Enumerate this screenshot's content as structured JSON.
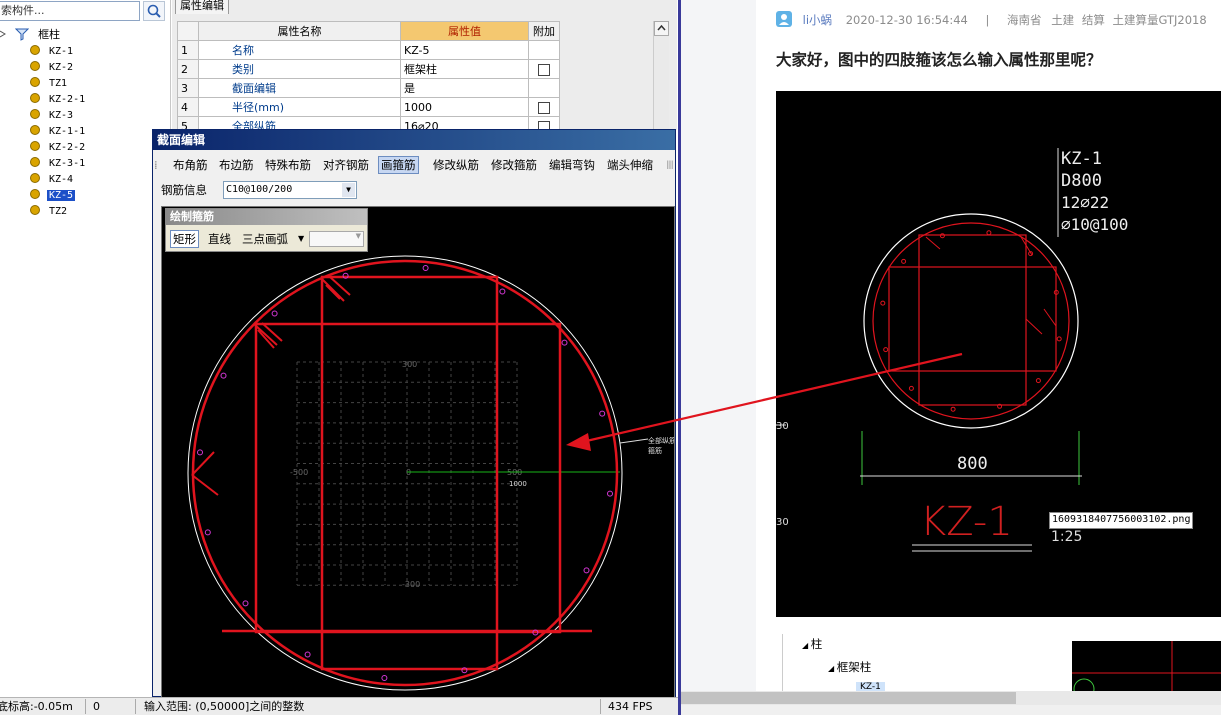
{
  "left_panel": {
    "search_placeholder": "索构件...",
    "tree_root": "框柱",
    "tree_items": [
      "KZ-1",
      "KZ-2",
      "TZ1",
      "KZ-2-1",
      "KZ-3",
      "KZ-1-1",
      "KZ-2-2",
      "KZ-3-1",
      "KZ-4",
      "KZ-5",
      "TZ2"
    ],
    "selected_item": "KZ-5"
  },
  "property_panel": {
    "tab_label": "属性编辑",
    "headers": [
      "属性名称",
      "属性值",
      "附加"
    ],
    "rows": [
      {
        "idx": "1",
        "name": "名称",
        "value": "KZ-5",
        "checkbox": false
      },
      {
        "idx": "2",
        "name": "类别",
        "value": "框架柱",
        "checkbox": true
      },
      {
        "idx": "3",
        "name": "截面编辑",
        "value": "是",
        "checkbox": false
      },
      {
        "idx": "4",
        "name": "半径(mm)",
        "value": "1000",
        "checkbox": true
      },
      {
        "idx": "5",
        "name": "全部纵筋",
        "value": "16⌀20",
        "checkbox": true
      }
    ]
  },
  "section_dialog": {
    "title": "截面编辑",
    "toolbar": [
      "布角筋",
      "布边筋",
      "特殊布筋",
      "对齐钢筋",
      "画箍筋",
      "修改纵筋",
      "修改箍筋",
      "编辑弯钩",
      "端头伸缩"
    ],
    "active_tool": "画箍筋",
    "rebar_info_label": "钢筋信息",
    "rebar_info_value": "C10@100/200",
    "draw_panel": {
      "title": "绘制箍筋",
      "tools": [
        "矩形",
        "直线",
        "三点画弧"
      ],
      "active_tool": "矩形"
    },
    "canvas_labels": {
      "top": "300",
      "bottom": "-300",
      "left": "-500",
      "right": "500",
      "center": "0",
      "radius": "1000",
      "callout_1": "全部纵筋",
      "callout_2": "箍筋"
    }
  },
  "status_bar": {
    "elevation": "底标高:-0.05m",
    "value": "0",
    "hint": "输入范围: (0,50000]之间的整数",
    "fps": "434 FPS"
  },
  "forum": {
    "username": "li小蜗",
    "datetime": "2020-12-30 16:54:44",
    "separator": "|",
    "tags": [
      "海南省",
      "土建",
      "结算",
      "土建算量GTJ2018"
    ],
    "question": "大家好，图中的四肢箍该怎么输入属性那里呢？",
    "drawing": {
      "label_name": "KZ-1",
      "label_dim": "D800",
      "label_main_rebar": "12⌀22",
      "label_stirrup": "⌀10@100",
      "dimension": "800",
      "title": "KZ-1",
      "scale": "1:25",
      "side_mark_1": "30",
      "side_mark_2": "30"
    },
    "tooltip": "1609318407756003102.png",
    "tree_items": [
      "柱",
      "框架柱",
      "KZ-1"
    ]
  },
  "colors": {
    "rebar_red": "#e0141e",
    "selection_blue": "#1c50c8",
    "header_value_bg": "#f4c870",
    "dialog_title": "#0a246a"
  }
}
